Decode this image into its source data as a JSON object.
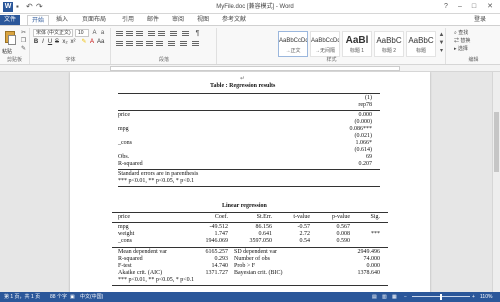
{
  "window": {
    "title": "MyFile.doc [兼容模式] - Word",
    "sign_in": "登录"
  },
  "tabs": [
    "文件",
    "开始",
    "插入",
    "页面布局",
    "引用",
    "邮件",
    "审阅",
    "视图",
    "参考文献"
  ],
  "ribbon": {
    "paste_label": "粘贴",
    "font_name": "宋体 (中文正文)",
    "font_size": "10",
    "groups": {
      "clipboard": "剪贴板",
      "font": "字体",
      "paragraph": "段落",
      "styles": "样式",
      "editing": "编辑"
    },
    "styles": [
      {
        "sample": "AaBbCcDd",
        "name": "→正文"
      },
      {
        "sample": "AaBbCcDd",
        "name": "→无间隔"
      },
      {
        "sample": "AaBl",
        "name": "标题 1"
      },
      {
        "sample": "AaBbC",
        "name": "标题 2"
      },
      {
        "sample": "AaBbC",
        "name": "标题"
      }
    ],
    "editing": {
      "find": "查找",
      "replace": "替换",
      "select": "选择"
    }
  },
  "table1": {
    "title": "Table : Regression results",
    "col_num": "(1)",
    "col_name": "rep78",
    "rows": [
      {
        "name": "price",
        "val": "0.000"
      },
      {
        "name": "",
        "val": "(0.000)"
      },
      {
        "name": "mpg",
        "val": "0.086***"
      },
      {
        "name": "",
        "val": "(0.021)"
      },
      {
        "name": "_cons",
        "val": "1.066*"
      },
      {
        "name": "",
        "val": "(0.614)"
      },
      {
        "name": "Obs.",
        "val": "69"
      },
      {
        "name": "R-squared",
        "val": "0.207"
      }
    ],
    "note1": "Standard errors are in parenthesis",
    "note2": "*** p<0.01, ** p<0.05, * p<0.1"
  },
  "table2": {
    "title": "Linear regression",
    "headers": [
      "price",
      "Coef.",
      "St.Err.",
      "t-value",
      "p-value",
      "Sig."
    ],
    "rows": [
      [
        "mpg",
        "-49.512",
        "86.156",
        "-0.57",
        "0.567",
        ""
      ],
      [
        "weight",
        "1.747",
        "0.641",
        "2.72",
        "0.008",
        "***"
      ],
      [
        "_cons",
        "1946.069",
        "3597.050",
        "0.54",
        "0.590",
        ""
      ]
    ],
    "stats": [
      [
        "Mean dependent var",
        "6165.257",
        "SD dependent var",
        "2949.496"
      ],
      [
        "R-squared",
        "0.293",
        "Number of obs",
        "74.000"
      ],
      [
        "F-test",
        "14.740",
        "Prob > F",
        "0.000"
      ],
      [
        "Akaike crit. (AIC)",
        "1371.727",
        "Bayesian crit. (BIC)",
        "1378.640"
      ]
    ],
    "note": "*** p<0.01, ** p<0.05, * p<0.1"
  },
  "status": {
    "page": "第 1 页，共 1 页",
    "words": "88 个字",
    "lang": "中文(中国)",
    "zoom": "110%"
  }
}
